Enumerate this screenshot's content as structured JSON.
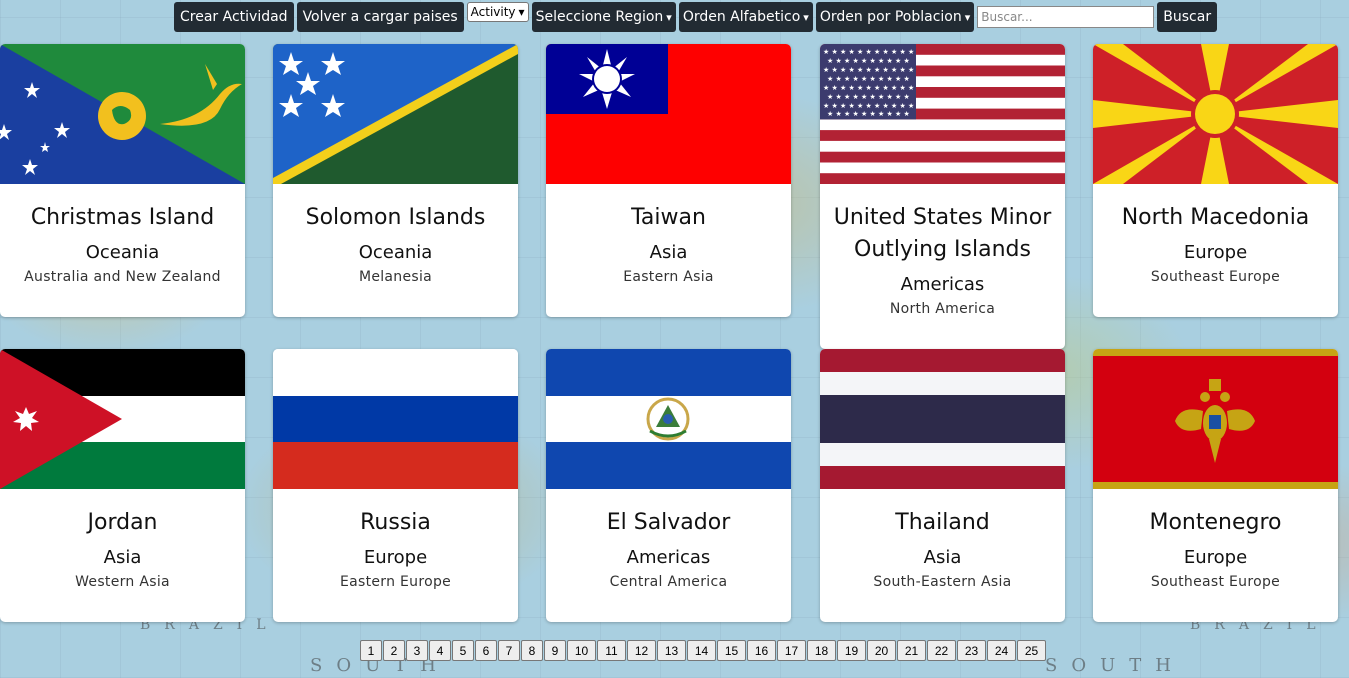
{
  "toolbar": {
    "create_activity": "Crear Actividad",
    "reload": "Volver a cargar paises",
    "activity_select": "Activity",
    "region_select": "Seleccione Region",
    "alpha_order": "Orden Alfabetico",
    "population_order": "Orden por Poblacion",
    "search_placeholder": "Buscar...",
    "search_button": "Buscar"
  },
  "countries": [
    {
      "name": "Christmas Island",
      "region": "Oceania",
      "subregion": "Australia and New Zealand"
    },
    {
      "name": "Solomon Islands",
      "region": "Oceania",
      "subregion": "Melanesia"
    },
    {
      "name": "Taiwan",
      "region": "Asia",
      "subregion": "Eastern Asia"
    },
    {
      "name": "United States Minor Outlying Islands",
      "region": "Americas",
      "subregion": "North America"
    },
    {
      "name": "North Macedonia",
      "region": "Europe",
      "subregion": "Southeast Europe"
    },
    {
      "name": "Jordan",
      "region": "Asia",
      "subregion": "Western Asia"
    },
    {
      "name": "Russia",
      "region": "Europe",
      "subregion": "Eastern Europe"
    },
    {
      "name": "El Salvador",
      "region": "Americas",
      "subregion": "Central America"
    },
    {
      "name": "Thailand",
      "region": "Asia",
      "subregion": "South-Eastern Asia"
    },
    {
      "name": "Montenegro",
      "region": "Europe",
      "subregion": "Southeast Europe"
    }
  ],
  "pagination": [
    "1",
    "2",
    "3",
    "4",
    "5",
    "6",
    "7",
    "8",
    "9",
    "10",
    "11",
    "12",
    "13",
    "14",
    "15",
    "16",
    "17",
    "18",
    "19",
    "20",
    "21",
    "22",
    "23",
    "24",
    "25"
  ],
  "map_labels": {
    "brazil": "BRAZIL",
    "south": "SOUTH"
  },
  "colors": {
    "toolbar_bg": "#222b33",
    "card_bg": "#ffffff",
    "map_water": "#a9cfe0"
  }
}
